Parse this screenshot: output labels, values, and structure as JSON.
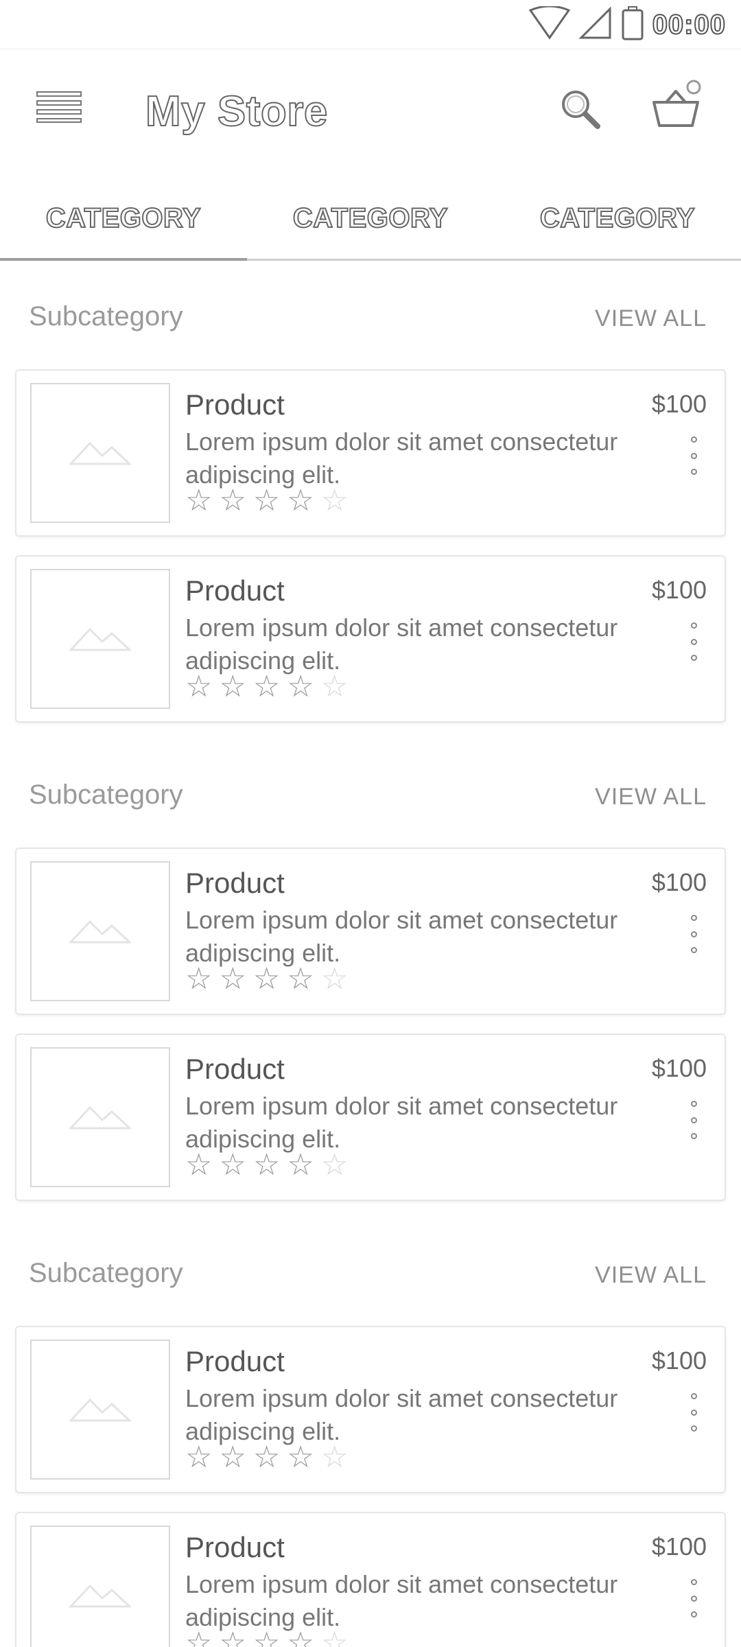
{
  "status_bar": {
    "time": "00:00",
    "icons": [
      "wifi-icon",
      "signal-icon",
      "battery-icon"
    ]
  },
  "app_bar": {
    "title": "My Store",
    "icons": [
      "menu-icon",
      "search-icon",
      "cart-icon"
    ]
  },
  "tabs": [
    {
      "label": "CATEGORY",
      "active": true
    },
    {
      "label": "CATEGORY",
      "active": false
    },
    {
      "label": "CATEGORY",
      "active": false
    }
  ],
  "sections": [
    {
      "title": "Subcategory",
      "view_all": "VIEW ALL",
      "products": [
        {
          "name": "Product",
          "price": "$100",
          "description": "Lorem ipsum dolor sit amet consectetur adipiscing elit.",
          "rating": 4,
          "max_rating": 5
        },
        {
          "name": "Product",
          "price": "$100",
          "description": "Lorem ipsum dolor sit amet consectetur adipiscing elit.",
          "rating": 4,
          "max_rating": 5
        }
      ]
    },
    {
      "title": "Subcategory",
      "view_all": "VIEW ALL",
      "products": [
        {
          "name": "Product",
          "price": "$100",
          "description": "Lorem ipsum dolor sit amet consectetur adipiscing elit.",
          "rating": 4,
          "max_rating": 5
        },
        {
          "name": "Product",
          "price": "$100",
          "description": "Lorem ipsum dolor sit amet consectetur adipiscing elit.",
          "rating": 4,
          "max_rating": 5
        }
      ]
    },
    {
      "title": "Subcategory",
      "view_all": "VIEW ALL",
      "products": [
        {
          "name": "Product",
          "price": "$100",
          "description": "Lorem ipsum dolor sit amet consectetur adipiscing elit.",
          "rating": 4,
          "max_rating": 5
        },
        {
          "name": "Product",
          "price": "$100",
          "description": "Lorem ipsum dolor sit amet consectetur adipiscing elit.",
          "rating": 4,
          "max_rating": 5
        }
      ]
    }
  ]
}
